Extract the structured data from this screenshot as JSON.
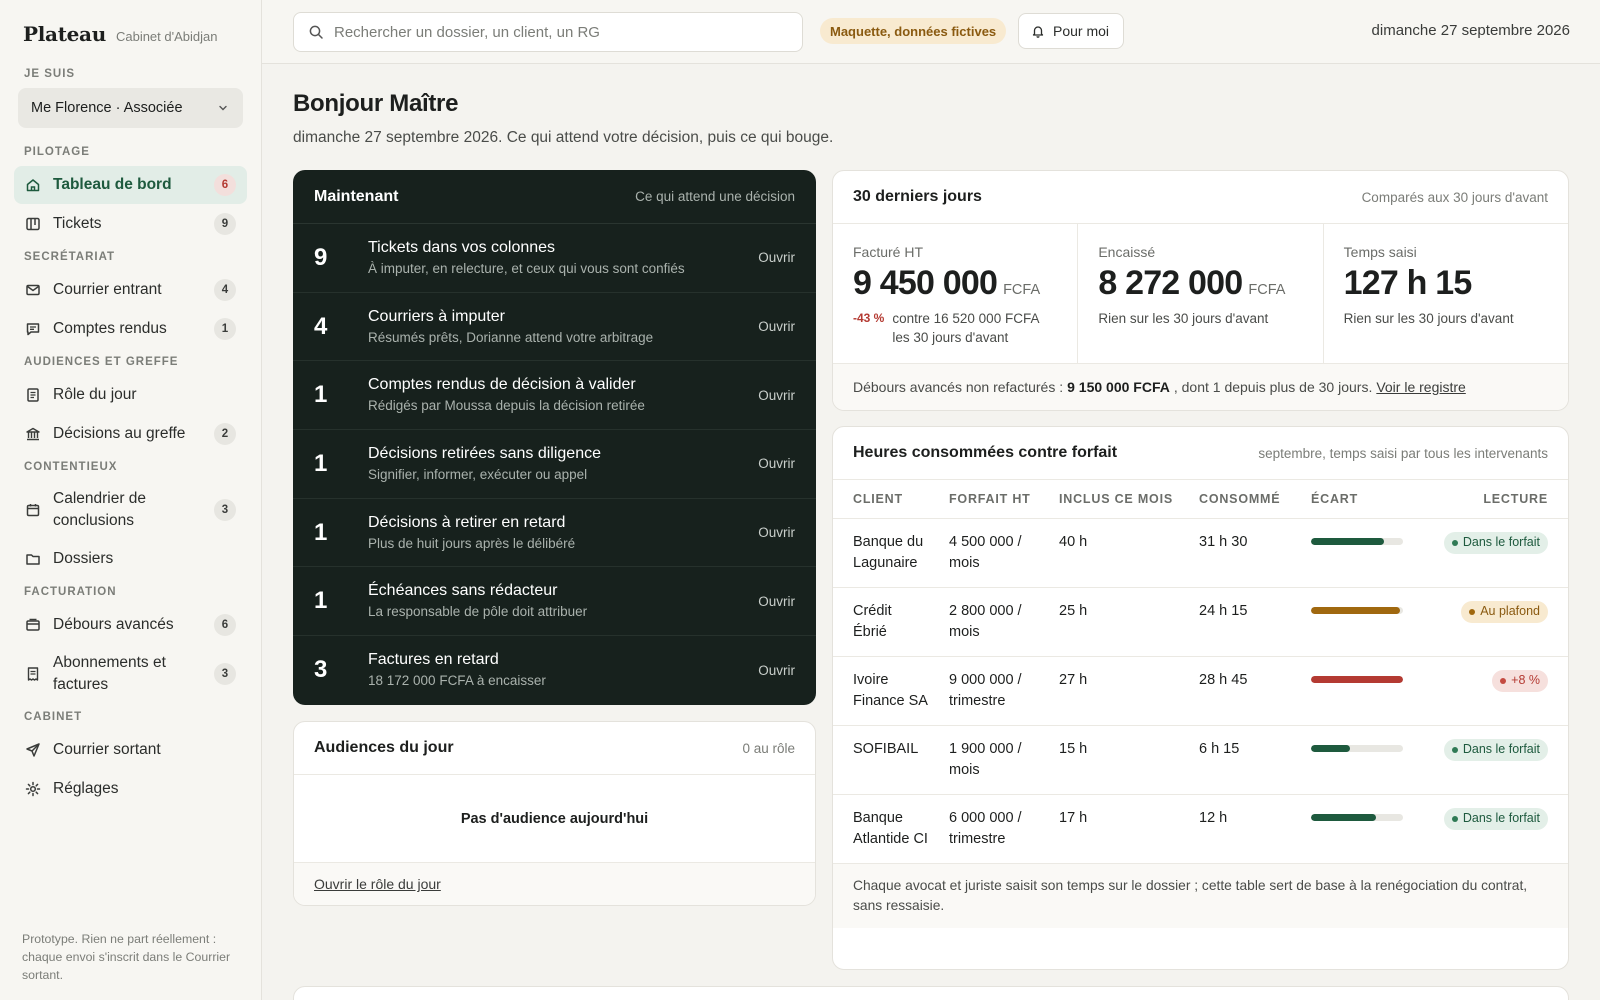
{
  "brand": {
    "name": "Plateau",
    "subtitle": "Cabinet d'Abidjan"
  },
  "sidebar": {
    "role_label": "JE SUIS",
    "role_value": "Me Florence · Associée",
    "groups": [
      {
        "label": "PILOTAGE",
        "items": [
          {
            "label": "Tableau de bord",
            "badge": "6",
            "icon": "home-icon",
            "active": true
          },
          {
            "label": "Tickets",
            "badge": "9",
            "icon": "kanban-icon"
          }
        ]
      },
      {
        "label": "SECRÉTARIAT",
        "items": [
          {
            "label": "Courrier entrant",
            "badge": "4",
            "icon": "mail-icon"
          },
          {
            "label": "Comptes rendus",
            "badge": "1",
            "icon": "message-icon"
          }
        ]
      },
      {
        "label": "AUDIENCES ET GREFFE",
        "items": [
          {
            "label": "Rôle du jour",
            "badge": "",
            "icon": "list-icon"
          },
          {
            "label": "Décisions au greffe",
            "badge": "2",
            "icon": "courthouse-icon"
          }
        ]
      },
      {
        "label": "CONTENTIEUX",
        "items": [
          {
            "label": "Calendrier de conclusions",
            "badge": "3",
            "icon": "calendar-icon"
          },
          {
            "label": "Dossiers",
            "badge": "",
            "icon": "folder-icon"
          }
        ]
      },
      {
        "label": "FACTURATION",
        "items": [
          {
            "label": "Débours avancés",
            "badge": "6",
            "icon": "wallet-icon"
          },
          {
            "label": "Abonnements et factures",
            "badge": "3",
            "icon": "invoice-icon"
          }
        ]
      },
      {
        "label": "CABINET",
        "items": [
          {
            "label": "Courrier sortant",
            "badge": "",
            "icon": "send-icon"
          },
          {
            "label": "Réglages",
            "badge": "",
            "icon": "gear-icon"
          }
        ]
      }
    ],
    "footer": "Prototype. Rien ne part réellement : chaque envoi s'inscrit dans le Courrier sortant."
  },
  "topbar": {
    "search_placeholder": "Rechercher un dossier, un client, un RG",
    "mock_tag": "Maquette, données fictives",
    "pour_moi": "Pour moi",
    "date": "dimanche 27 septembre 2026"
  },
  "greeting": {
    "title": "Bonjour Maître",
    "subtitle": "dimanche 27 septembre 2026. Ce qui attend votre décision, puis ce qui bouge."
  },
  "now": {
    "title": "Maintenant",
    "subtitle": "Ce qui attend une décision",
    "open_label": "Ouvrir",
    "rows": [
      {
        "count": "9",
        "label": "Tickets dans vos colonnes",
        "desc": "À imputer, en relecture, et ceux qui vous sont confiés"
      },
      {
        "count": "4",
        "label": "Courriers à imputer",
        "desc": "Résumés prêts, Dorianne attend votre arbitrage"
      },
      {
        "count": "1",
        "label": "Comptes rendus de décision à valider",
        "desc": "Rédigés par Moussa depuis la décision retirée"
      },
      {
        "count": "1",
        "label": "Décisions retirées sans diligence",
        "desc": "Signifier, informer, exécuter ou appel"
      },
      {
        "count": "1",
        "label": "Décisions à retirer en retard",
        "desc": "Plus de huit jours après le délibéré"
      },
      {
        "count": "1",
        "label": "Échéances sans rédacteur",
        "desc": "La responsable de pôle doit attribuer"
      },
      {
        "count": "3",
        "label": "Factures en retard",
        "desc": "18 172 000 FCFA à encaisser"
      }
    ]
  },
  "audiences": {
    "title": "Audiences du jour",
    "count": "0 au rôle",
    "empty": "Pas d'audience aujourd'hui",
    "link": "Ouvrir le rôle du jour"
  },
  "kpis": {
    "title": "30 derniers jours",
    "subtitle": "Comparés aux 30 jours d'avant",
    "facture": {
      "label": "Facturé HT",
      "value": "9 450 000",
      "unit": "FCFA",
      "delta": "-43 %",
      "compare": "contre 16 520 000 FCFA les 30 jours d'avant"
    },
    "encaisse": {
      "label": "Encaissé",
      "value": "8 272 000",
      "unit": "FCFA",
      "note": "Rien sur les 30 jours d'avant"
    },
    "temps": {
      "label": "Temps saisi",
      "value": "127 h 15",
      "note": "Rien sur les 30 jours d'avant"
    },
    "footer_pre": "Débours avancés non refacturés :",
    "footer_amount": "9 150 000 FCFA",
    "footer_post": ", dont 1 depuis plus de 30 jours.",
    "footer_link": "Voir le registre"
  },
  "hours": {
    "title": "Heures consommées contre forfait",
    "subtitle": "septembre, temps saisi par tous les intervenants",
    "columns": [
      "CLIENT",
      "FORFAIT HT",
      "INCLUS CE MOIS",
      "CONSOMMÉ",
      "ÉCART",
      "LECTURE"
    ],
    "rows": [
      {
        "client": "Banque du Lagunaire",
        "forfait": "4 500 000 / mois",
        "inclus": "40 h",
        "consomme": "31 h 30",
        "ratio": 0.79,
        "color": "#1e5a3e",
        "status": "Dans le forfait",
        "status_kind": "ok"
      },
      {
        "client": "Crédit Ébrié",
        "forfait": "2 800 000 / mois",
        "inclus": "25 h",
        "consomme": "24 h 15",
        "ratio": 0.97,
        "color": "#a0680f",
        "status": "Au plafond",
        "status_kind": "warn"
      },
      {
        "client": "Ivoire Finance SA",
        "forfait": "9 000 000 / trimestre",
        "inclus": "27 h",
        "consomme": "28 h 45",
        "ratio": 1.0,
        "color": "#b43a32",
        "status": "+8 %",
        "status_kind": "over"
      },
      {
        "client": "SOFIBAIL",
        "forfait": "1 900 000 / mois",
        "inclus": "15 h",
        "consomme": "6 h 15",
        "ratio": 0.42,
        "color": "#1e5a3e",
        "status": "Dans le forfait",
        "status_kind": "ok"
      },
      {
        "client": "Banque Atlantide CI",
        "forfait": "6 000 000 / trimestre",
        "inclus": "17 h",
        "consomme": "12 h",
        "ratio": 0.71,
        "color": "#1e5a3e",
        "status": "Dans le forfait",
        "status_kind": "ok"
      }
    ],
    "footer": "Chaque avocat et juriste saisit son temps sur le dossier ; cette table sert de base à la renégociation du contrat, sans ressaisie."
  }
}
